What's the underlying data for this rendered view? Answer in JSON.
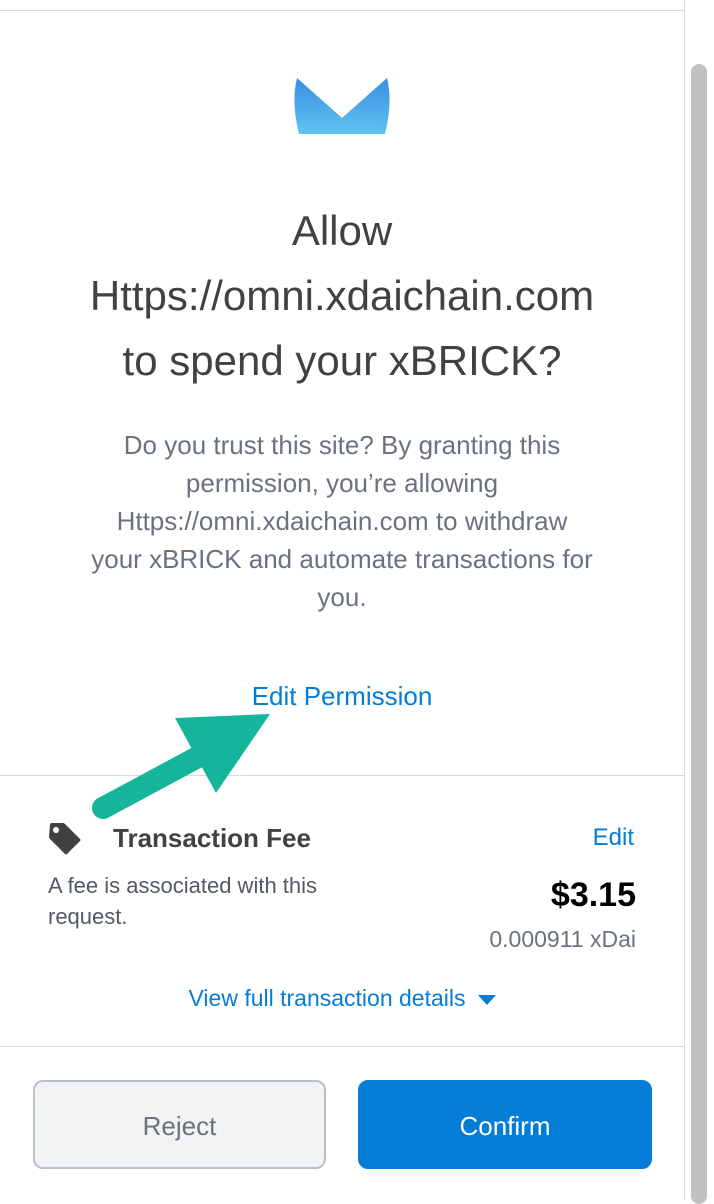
{
  "title": {
    "line1": "Allow",
    "line2": "Https://omni.xdaichain.com",
    "line3": "to spend your xBRICK?"
  },
  "description": {
    "line1": "Do you trust this site? By granting this",
    "line2": "permission, you’re allowing",
    "line3": "Https://omni.xdaichain.com to withdraw",
    "line4": "your xBRICK and automate transactions for",
    "line5": "you."
  },
  "edit_permission_label": "Edit Permission",
  "fee": {
    "icon": "tag-icon",
    "title": "Transaction Fee",
    "edit_label": "Edit",
    "description_line1": "A fee is associated with this",
    "description_line2": "request.",
    "fiat_amount": "$3.15",
    "native_amount": "0.000911 xDai"
  },
  "view_details_label": "View full transaction details",
  "buttons": {
    "reject_label": "Reject",
    "confirm_label": "Confirm"
  },
  "colors": {
    "accent": "#037dd6",
    "annotation_arrow": "#15b59b",
    "logo_gradient_top": "#3a8fe3",
    "logo_gradient_bottom": "#5ec3ef"
  }
}
